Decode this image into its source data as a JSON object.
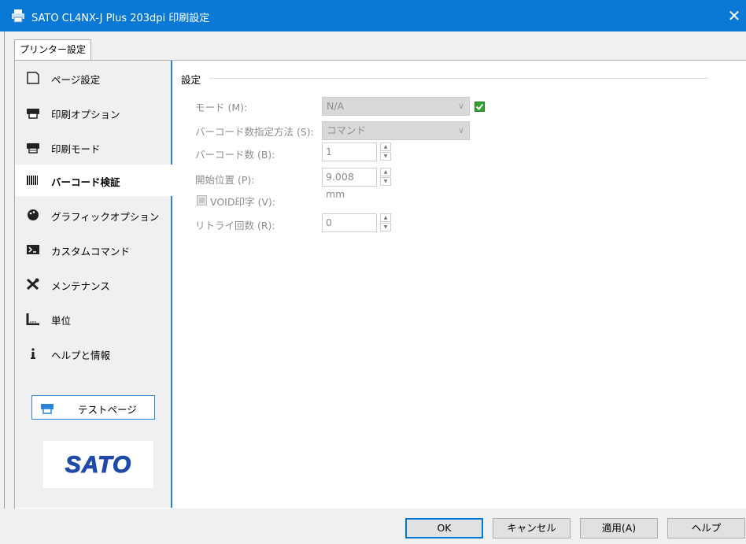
{
  "window": {
    "title": "SATO CL4NX-J Plus 203dpi 印刷設定",
    "close_glyph": "✕"
  },
  "tab": {
    "label": "プリンター設定"
  },
  "sidebar": {
    "items": [
      {
        "label": "ページ設定",
        "icon": "page-icon"
      },
      {
        "label": "印刷オプション",
        "icon": "printer-icon"
      },
      {
        "label": "印刷モード",
        "icon": "printer-mode-icon"
      },
      {
        "label": "バーコード検証",
        "icon": "barcode-icon",
        "selected": true
      },
      {
        "label": "グラフィックオプション",
        "icon": "palette-icon"
      },
      {
        "label": "カスタムコマンド",
        "icon": "terminal-icon"
      },
      {
        "label": "メンテナンス",
        "icon": "tools-icon"
      },
      {
        "label": "単位",
        "icon": "ruler-icon"
      },
      {
        "label": "ヘルプと情報",
        "icon": "info-icon"
      }
    ],
    "test_page_label": "テストページ",
    "logo_text": "SATO"
  },
  "settings": {
    "group_title": "設定",
    "mode": {
      "label": "モード (M):",
      "value": "N/A",
      "checked": true
    },
    "barcode_count_method": {
      "label": "バーコード数指定方法 (S):",
      "value": "コマンド"
    },
    "barcode_count": {
      "label": "バーコード数 (B):",
      "value": "1"
    },
    "start_position": {
      "label": "開始位置 (P):",
      "value": "9.008 mm"
    },
    "void_print": {
      "label": "VOID印字 (V):",
      "checked": false
    },
    "retry_count": {
      "label": "リトライ回数 (R):",
      "value": "0"
    }
  },
  "buttons": {
    "ok": "OK",
    "cancel": "キャンセル",
    "apply": "適用(A)",
    "help": "ヘルプ"
  },
  "colors": {
    "titlebar": "#0a78d7",
    "accent": "#2b84d6",
    "check": "#2fa52f"
  }
}
